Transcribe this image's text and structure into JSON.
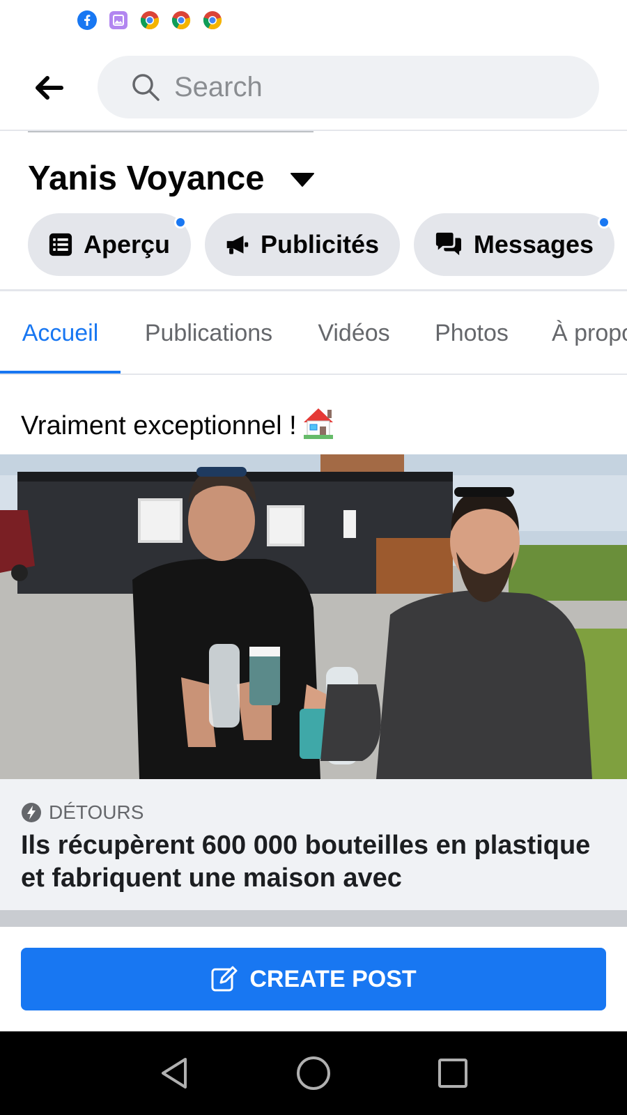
{
  "status_bar": {
    "icons": [
      "facebook-icon",
      "gallery-icon",
      "chrome-icon",
      "chrome-icon",
      "chrome-icon"
    ]
  },
  "search": {
    "placeholder": "Search"
  },
  "page": {
    "title": "Yanis Voyance"
  },
  "actions": [
    {
      "label": "Aperçu",
      "icon": "list-icon",
      "has_dot": true
    },
    {
      "label": "Publicités",
      "icon": "megaphone-icon",
      "has_dot": false
    },
    {
      "label": "Messages",
      "icon": "chat-icon",
      "has_dot": true
    }
  ],
  "tabs": [
    {
      "label": "Accueil",
      "active": true
    },
    {
      "label": "Publications",
      "active": false
    },
    {
      "label": "Vidéos",
      "active": false
    },
    {
      "label": "Photos",
      "active": false
    },
    {
      "label": "À propos",
      "active": false
    }
  ],
  "post": {
    "text": "Vraiment exceptionnel !",
    "emoji": "🏠",
    "link": {
      "source": "DÉTOURS",
      "headline": "Ils récupèrent 600 000 bouteilles en plastique et fabriquent une maison avec"
    }
  },
  "create_post": {
    "label": "CREATE POST"
  },
  "colors": {
    "accent": "#1877f2",
    "pill_bg": "#e4e6eb",
    "card_bg": "#f0f2f5"
  }
}
